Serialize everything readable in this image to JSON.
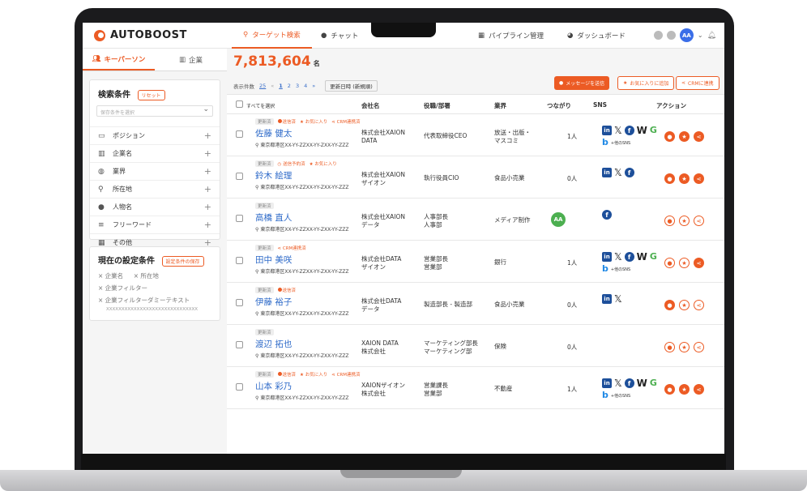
{
  "app": {
    "logo": "AUTOBOOST"
  },
  "nav": {
    "tabs": [
      {
        "label": "ターゲット検索"
      },
      {
        "label": "チャット"
      },
      {
        "label": "パイプライン管理"
      },
      {
        "label": "ダッシュボード"
      }
    ],
    "user_initials": "AA"
  },
  "sidebar": {
    "person_tab": "キーパーソン",
    "company_tab": "企業",
    "search_title": "検索条件",
    "reset_label": "リセット",
    "saved_placeholder": "保存条件を選択",
    "filters": [
      {
        "label": "ポジション",
        "icon": "id-card-icon"
      },
      {
        "label": "企業名",
        "icon": "building-icon"
      },
      {
        "label": "業界",
        "icon": "globe-icon"
      },
      {
        "label": "所在地",
        "icon": "pin-icon"
      },
      {
        "label": "人物名",
        "icon": "person-icon"
      },
      {
        "label": "フリーワード",
        "icon": "text-icon"
      },
      {
        "label": "その他",
        "icon": "grid-icon"
      }
    ],
    "current_title": "現在の設定条件",
    "save_label": "設定条件の保存",
    "chips": [
      "× 企業名",
      "× 所在地",
      "× 企業フィルター",
      "× 企業フィルターダミーテキスト"
    ],
    "chip_sub": "XXXXXXXXXXXXXXXXXXXXXXXXXXXXXX"
  },
  "main": {
    "count": "7,813,604",
    "count_unit": "名",
    "page_size_label": "表示件数",
    "page_size": "25",
    "pages": [
      "1",
      "2",
      "3",
      "4"
    ],
    "sort_label": "更新日時 (新規順)",
    "actions": {
      "message": "メッセージを送信",
      "favorite": "お気に入りに追加",
      "crm": "CRMに連携"
    },
    "headers": {
      "select_all": "すべてを選択",
      "company": "会社名",
      "role": "役職/部署",
      "industry": "業界",
      "connection": "つながり",
      "sns": "SNS",
      "action": "アクション"
    },
    "tag_labels": {
      "updated": "更新済",
      "sent": "送信済",
      "scheduled": "送信予約済",
      "favorite": "お気に入り",
      "crm": "CRM連携済"
    },
    "sns_more": "+他のSNS"
  },
  "rows": [
    {
      "name": "佐藤 健太",
      "addr": "東京都港区XX-YY-ZZXX-YY-ZXX-YY-ZZZ",
      "company": "株式会社XAION\nDATA",
      "role": "代表取締役CEO",
      "industry": "放送・出版・\nマスコミ",
      "conn": "1人"
    },
    {
      "name": "鈴木 絵理",
      "addr": "東京都港区XX-YY-ZZXX-YY-ZXX-YY-ZZZ",
      "company": "株式会社XAION\nザイオン",
      "role": "執行役員CIO",
      "industry": "食品小売業",
      "conn": "0人"
    },
    {
      "name": "高橋 直人",
      "addr": "東京都港区XX-YY-ZZXX-YY-ZXX-YY-ZZZ",
      "company": "株式会社XAION\nデータ",
      "role": "人事部長\n人事部",
      "industry": "メディア制作",
      "conn": "AA"
    },
    {
      "name": "田中 美咲",
      "addr": "東京都港区XX-YY-ZZXX-YY-ZXX-YY-ZZZ",
      "company": "株式会社DATA\nザイオン",
      "role": "営業部長\n営業部",
      "industry": "銀行",
      "conn": "1人"
    },
    {
      "name": "伊藤 裕子",
      "addr": "東京都港区XX-YY-ZZXX-YY-ZXX-YY-ZZZ",
      "company": "株式会社DATA\nデータ",
      "role": "製造部長 - 製造部",
      "industry": "食品小売業",
      "conn": "0人"
    },
    {
      "name": "渡辺 拓也",
      "addr": "東京都港区XX-YY-ZZXX-YY-ZXX-YY-ZZZ",
      "company": "XAION DATA\n株式会社",
      "role": "マーケティング部長\nマーケティング部",
      "industry": "保険",
      "conn": "0人"
    },
    {
      "name": "山本 彩乃",
      "addr": "東京都港区XX-YY-ZZXX-YY-ZXX-YY-ZZZ",
      "company": "XAIONザイオン\n株式会社",
      "role": "営業課長\n営業部",
      "industry": "不動産",
      "conn": "1人"
    }
  ]
}
